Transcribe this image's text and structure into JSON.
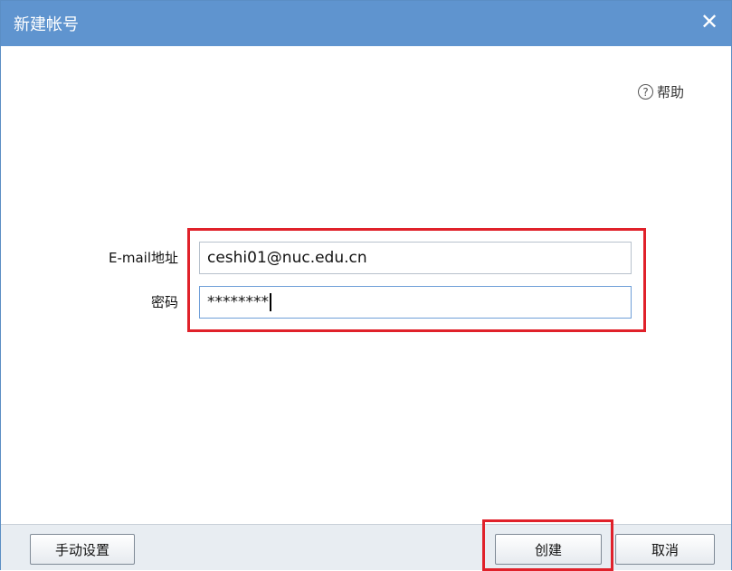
{
  "window": {
    "title": "新建帐号",
    "close_glyph": "✕"
  },
  "help": {
    "icon": "question-circle-icon",
    "glyph": "?",
    "label": "帮助"
  },
  "form": {
    "email_label": "E-mail地址",
    "email_value": "ceshi01@nuc.edu.cn",
    "password_label": "密码",
    "password_value": "********"
  },
  "footer": {
    "manual_label": "手动设置",
    "create_label": "创建",
    "cancel_label": "取消"
  },
  "colors": {
    "titlebar": "#5f94cf",
    "highlight": "#e0212a",
    "footer": "#e8edf2"
  }
}
